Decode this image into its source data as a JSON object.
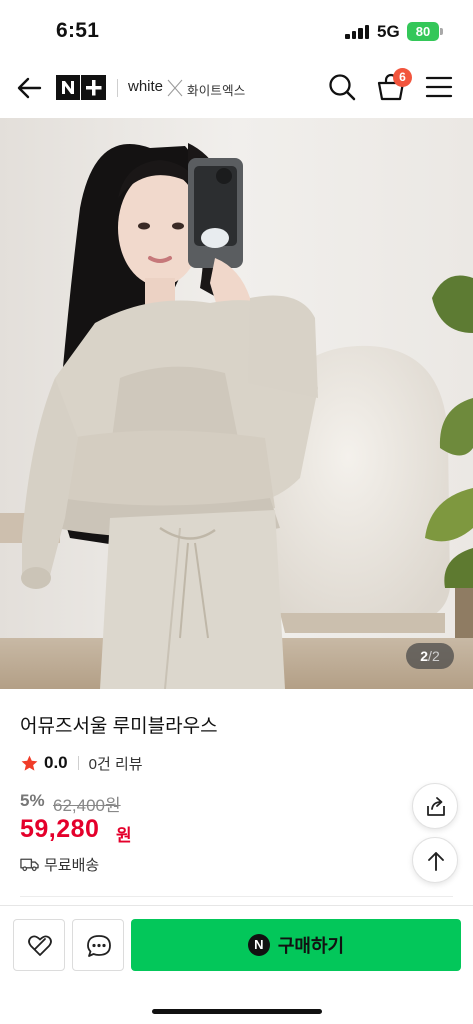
{
  "status_bar": {
    "time": "6:51",
    "network": "5G",
    "battery": "80"
  },
  "nav": {
    "brand_white": "white",
    "brand_korean": "화이트엑스",
    "cart_count": "6"
  },
  "gallery": {
    "current": "2",
    "separator": "/",
    "total": "2"
  },
  "product": {
    "title": "어뮤즈서울 루미블라우스",
    "rating": "0.0",
    "review_count": "0건 리뷰",
    "discount": "5%",
    "original_price": "62,400원",
    "sale_price": "59,280",
    "currency": "원",
    "shipping": "무료배송"
  },
  "bottom_bar": {
    "buy_label": "구매하기",
    "naver_letter": "N"
  },
  "colors": {
    "accent_green": "#03c75a",
    "price_red": "#e4002b",
    "badge_red": "#f2553d",
    "battery_green": "#34c759"
  }
}
